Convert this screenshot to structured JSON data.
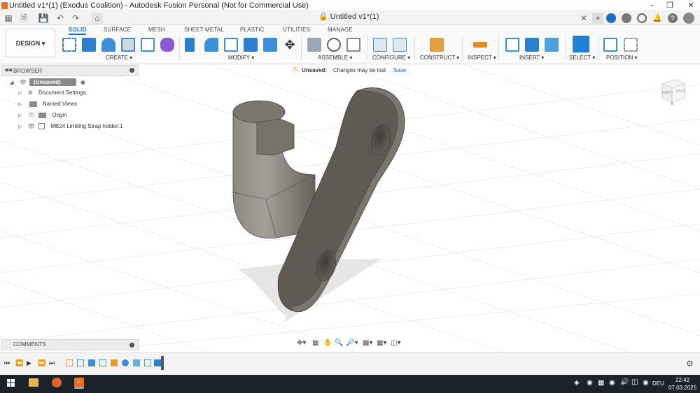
{
  "window": {
    "title": "Untitled v1*(1) (Exodus Coalition) - Autodesk Fusion Personal (Not for Commercial Use)",
    "document_tab": "Untitled v1*(1)"
  },
  "workspace": {
    "label": "DESIGN"
  },
  "ribbon_tabs": [
    "SOLID",
    "SURFACE",
    "MESH",
    "SHEET METAL",
    "PLASTIC",
    "UTILITIES",
    "MANAGE"
  ],
  "ribbon_groups": [
    "CREATE",
    "MODIFY",
    "ASSEMBLE",
    "CONFIGURE",
    "CONSTRUCT",
    "INSPECT",
    "INSERT",
    "SELECT",
    "POSITION"
  ],
  "browser": {
    "title": "BROWSER",
    "root": "(Unsaved)",
    "items": [
      "Document Settings",
      "Named Views",
      "Origin",
      "MB24 Limiting Strap holder:1"
    ]
  },
  "unsaved_banner": {
    "label": "Unsaved:",
    "message": "Changes may be lost",
    "save": "Save"
  },
  "viewcube": {
    "face_right": "RIGHT",
    "face_back": "BACK"
  },
  "comments": {
    "title": "COMMENTS"
  },
  "taskbar": {
    "language": "DEU",
    "time": "22:42",
    "date": "07.03.2025"
  },
  "colors": {
    "accent": "#1a6fc4",
    "model": "#6e6a62",
    "taskbar": "#1c2229",
    "fusion_orange": "#f26a1d"
  }
}
